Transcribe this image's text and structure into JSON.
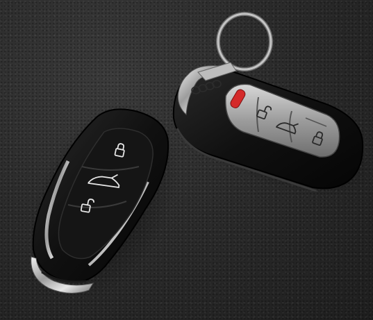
{
  "scene": {
    "colors": {
      "surface": "#2b2b2b",
      "fob_body": "#0e0e0e",
      "chrome": "#c9c9c9",
      "audi_buttons": "#9a9a9a",
      "panic_button": "#d42a2a",
      "key_ring": "#b5b5b5"
    },
    "objects": [
      {
        "name": "flip-key-fob",
        "buttons": [
          "lock-icon",
          "trunk-icon",
          "unlock-icon"
        ]
      },
      {
        "name": "audi-smart-key",
        "buttons": [
          "panic-button",
          "unlock-icon",
          "trunk-icon",
          "lock-icon"
        ]
      },
      {
        "name": "key-ring"
      }
    ]
  }
}
